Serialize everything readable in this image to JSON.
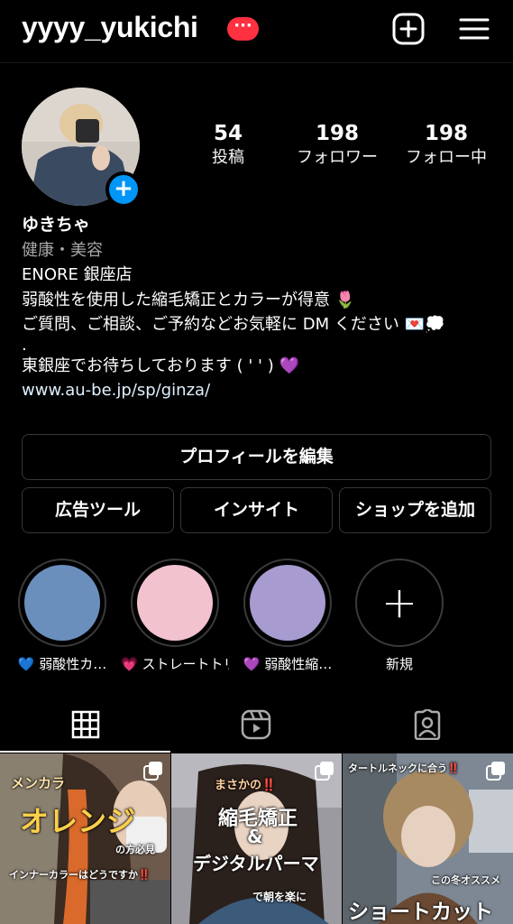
{
  "header": {
    "username": "yyyy_yukichi",
    "badge": "···"
  },
  "stats": [
    {
      "value": "54",
      "label": "投稿"
    },
    {
      "value": "198",
      "label": "フォロワー"
    },
    {
      "value": "198",
      "label": "フォロー中"
    }
  ],
  "bio": {
    "name": "ゆきちゃ",
    "category": "健康・美容",
    "lines": [
      "ENORE 銀座店",
      "弱酸性を使用した縮毛矯正とカラーが得意 🌷",
      "ご質問、ご相談、ご予約などお気軽に DM ください 💌💭",
      ".",
      "東銀座でお待ちしております ( ' ' ) 💜"
    ],
    "link": "www.au-be.jp/sp/ginza/"
  },
  "buttons": {
    "edit_profile": "プロフィールを編集",
    "ad_tools": "広告ツール",
    "insights": "インサイト",
    "add_shop": "ショップを追加"
  },
  "highlights": [
    {
      "label": "💙 弱酸性カ…",
      "color": "#6b8fbd"
    },
    {
      "label": "💗 ストレートトリー…",
      "color": "#f2c2cf"
    },
    {
      "label": "💜 弱酸性縮…",
      "color": "#a79bd0"
    },
    {
      "label": "新規"
    }
  ],
  "posts": [
    {
      "captions": [
        "メンカラ",
        "オレンジ",
        "の方必見",
        "インナーカラーはどうですか‼️"
      ]
    },
    {
      "captions": [
        "まさかの‼️",
        "縮毛矯正",
        "&",
        "デジタルパーマ",
        "で朝を楽に"
      ]
    },
    {
      "captions": [
        "タートルネックに合う‼️",
        "この冬オススメ",
        "ショートカット"
      ]
    }
  ],
  "colors": {
    "accent": "#0095f6",
    "badge": "#ff3040",
    "background": "#000000"
  },
  "icons": [
    "plus-square-icon",
    "hamburger-menu-icon",
    "grid-icon",
    "reels-icon",
    "tagged-icon",
    "multiple-posts-icon"
  ]
}
